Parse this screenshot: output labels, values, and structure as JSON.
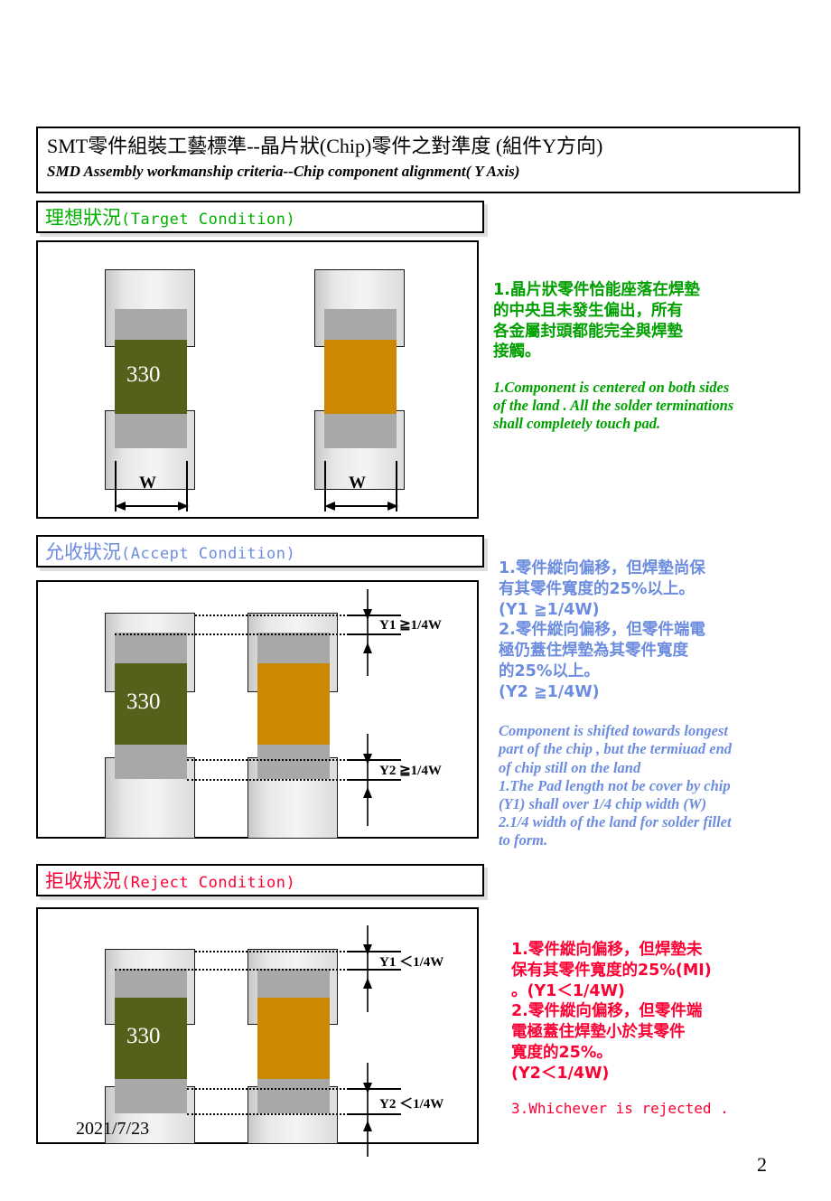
{
  "title": {
    "chinese": "SMT零件組裝工藝標準--晶片狀(Chip)零件之對準度 (組件Y方向)",
    "english": "SMD Assembly workmanship criteria--Chip component alignment( Y Axis)"
  },
  "sections": {
    "target": {
      "label_cn": "理想狀況",
      "label_en": "(Target Condition)",
      "color": "#00b000",
      "text_cn": "1.晶片狀零件恰能座落在焊墊\n   的中央且未發生偏出，所有\n   各金屬封頭都能完全與焊墊\n   接觸。",
      "text_en": "1.Component is centered on both sides\nof the land . All the solder terminations\nshall completely touch pad."
    },
    "accept": {
      "label_cn": "允收狀況",
      "label_en": "(Accept Condition)",
      "color": "#6c8cdf",
      "text_cn": "1.零件縱向偏移，但焊墊尚保\n   有其零件寬度的25%以上。\n   (Y1 ≧1/4W)\n2.零件縱向偏移，但零件端電\n   極仍蓋住焊墊為其零件寬度\n   的25%以上。\n   (Y2 ≧1/4W)",
      "text_en": "Component is shifted towards longest\npart of the chip , but the termiuad end\nof chip still on the land\n1.The Pad length not be cover by chip\n(Y1) shall over 1/4 chip width (W)\n2.1/4 width of the land for solder fillet\nto form."
    },
    "reject": {
      "label_cn": "拒收狀況",
      "label_en": "(Reject Condition)",
      "color": "#fd0033",
      "text_cn": "1.零件縱向偏移，但焊墊未\n   保有其零件寬度的25%(MI)\n   。(Y1＜1/4W)\n2.零件縱向偏移，但零件端\n   電極蓋住焊墊小於其零件\n   寬度的25%。\n   (Y2＜1/4W)",
      "text_en": "3.Whichever is rejected ."
    }
  },
  "diagrams": {
    "component_label": "330",
    "target": {
      "dimension_left": "W",
      "dimension_right": "W"
    },
    "accept": {
      "dim_y1": "Y1 ≧1/4W",
      "dim_y2": "Y2 ≧1/4W"
    },
    "reject": {
      "dim_y1": "Y1 ＜1/4W",
      "dim_y2": "Y2 ＜1/4W"
    }
  },
  "colors": {
    "resistor_body": "#55601a",
    "capacitor_body": "#cc8800",
    "termination": "#a8a8a8",
    "pad": "#dcdcdc"
  },
  "footer": {
    "date": "2021/7/23",
    "page_number": "2"
  }
}
